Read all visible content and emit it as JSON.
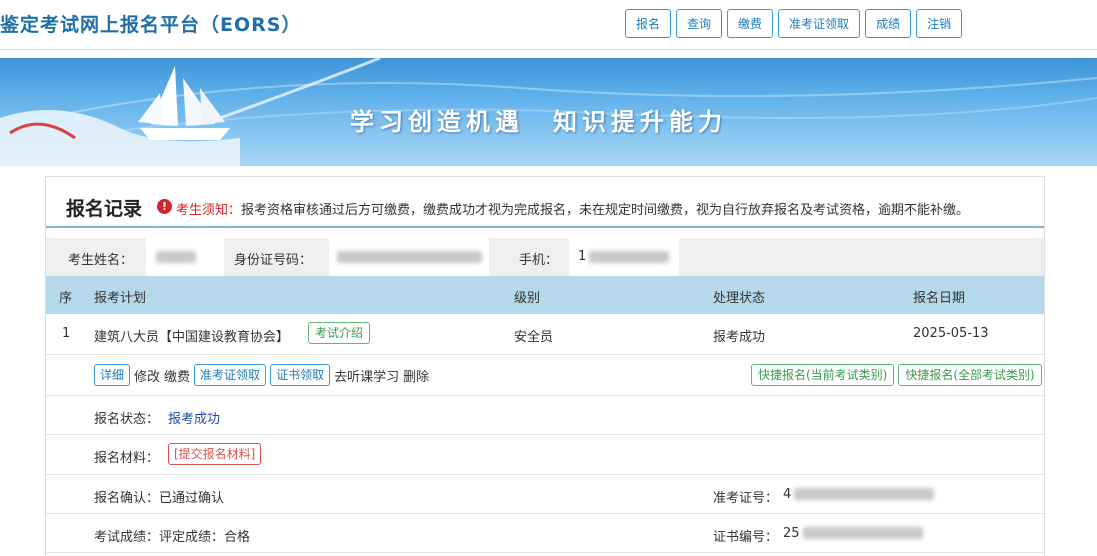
{
  "header": {
    "title": "鉴定考试网上报名平台（EORS）",
    "nav": [
      "报名",
      "查询",
      "缴费",
      "准考证领取",
      "成绩",
      "注销"
    ]
  },
  "banner": {
    "slogan": "学习创造机遇　知识提升能力"
  },
  "record": {
    "title": "报名记录",
    "notice_label": "考生须知：",
    "notice_text": "报考资格审核通过后方可缴费，缴费成功才视为完成报名，未在规定时间缴费，视为自行放弃报名及考试资格，逾期不能补缴。",
    "info": {
      "name_label": "考生姓名：",
      "id_label": "身份证号码：",
      "phone_label": "手机：",
      "phone_visible": "1"
    },
    "columns": [
      "序",
      "报考计划",
      "级别",
      "处理状态",
      "报名日期"
    ],
    "row": {
      "index": "1",
      "plan": "建筑八大员【中国建设教育协会】",
      "intro_button": "考试介绍",
      "level": "安全员",
      "status": "报考成功",
      "date": "2025-05-13"
    },
    "actions": {
      "detail": "详细",
      "modify": "修改",
      "pay": "缴费",
      "admission": "准考证领取",
      "certificate": "证书领取",
      "study": "去听课学习",
      "delete": "删除",
      "quick_current": "快捷报名(当前考试类别)",
      "quick_all": "快捷报名(全部考试类别)"
    },
    "details": {
      "reg_status_label": "报名状态：",
      "reg_status_value": "报考成功",
      "material_label": "报名材料：",
      "material_button": "[提交报名材料]",
      "confirm_text": "报名确认：已通过确认",
      "admission_label": "准考证号：",
      "admission_visible": "4",
      "score_text": "考试成绩：评定成绩：合格",
      "cert_label": "证书编号：",
      "cert_visible": "25"
    }
  },
  "colors": {
    "accent_blue": "#1f7bbf",
    "header_row": "#b5d9ea",
    "warn_red": "#d9232a",
    "green": "#3a9a52"
  }
}
